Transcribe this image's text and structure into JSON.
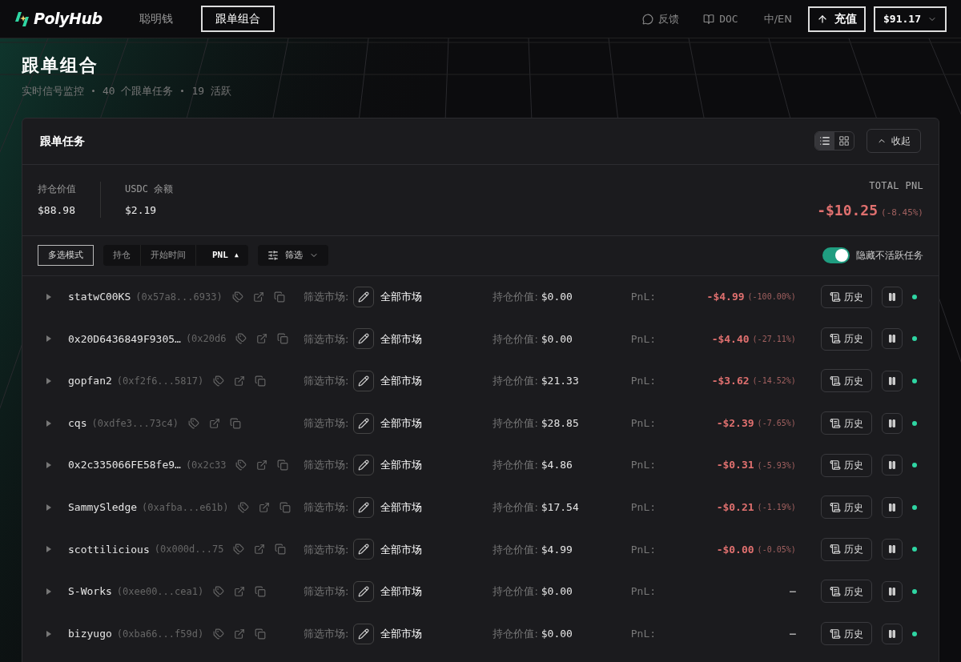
{
  "nav": {
    "logo": "PolyHub",
    "links": [
      {
        "label": "聪明钱",
        "selected": false
      },
      {
        "label": "跟单组合",
        "selected": true
      }
    ],
    "feedback": "反馈",
    "doc": "DOC",
    "language": "中/EN",
    "deposit": "充值",
    "balance": "$91.17"
  },
  "hero": {
    "title": "跟单组合",
    "subtitle": [
      "实时信号监控",
      "40 个跟单任务",
      "19 活跃"
    ]
  },
  "panel": {
    "title": "跟单任务",
    "views": [
      {
        "kind": "list",
        "selected": true
      },
      {
        "kind": "grid",
        "selected": false
      }
    ],
    "collapse": "收起",
    "stats": [
      {
        "label": "持仓价值",
        "value": "$88.98"
      },
      {
        "label": "USDC 余额",
        "value": "$2.19"
      }
    ],
    "total_pnl": {
      "label": "TOTAL PNL",
      "value": "-$10.25",
      "percent": "(-8.45%)"
    },
    "multi_select": "多选模式",
    "sort_tabs": [
      {
        "label": "持仓",
        "selected": false
      },
      {
        "label": "开始时间",
        "selected": false
      },
      {
        "label": "PNL",
        "selected": true,
        "arrow": "▲"
      }
    ],
    "filter": "筛选",
    "hide_inactive": {
      "label": "隐藏不活跃任务",
      "on": true
    },
    "tasks": [
      {
        "name": "statwC00KS",
        "address": "(0x57a8...6933)",
        "expanded": false,
        "filter_label": "筛选市场:",
        "market": "全部市场",
        "position_label": "持仓价值:",
        "position": "$0.00",
        "pnl_label": "PnL:",
        "pnl": "-$4.99",
        "pnl_percent": "(-100.00%)",
        "history": "历史",
        "active": true
      },
      {
        "name": "0x20D6436849F9305…",
        "address": "(0x20d6",
        "expanded": false,
        "filter_label": "筛选市场:",
        "market": "全部市场",
        "position_label": "持仓价值:",
        "position": "$0.00",
        "pnl_label": "PnL:",
        "pnl": "-$4.40",
        "pnl_percent": "(-27.11%)",
        "history": "历史",
        "active": true
      },
      {
        "name": "gopfan2",
        "address": "(0xf2f6...5817)",
        "expanded": false,
        "filter_label": "筛选市场:",
        "market": "全部市场",
        "position_label": "持仓价值:",
        "position": "$21.33",
        "pnl_label": "PnL:",
        "pnl": "-$3.62",
        "pnl_percent": "(-14.52%)",
        "history": "历史",
        "active": true
      },
      {
        "name": "cqs",
        "address": "(0xdfe3...73c4)",
        "expanded": false,
        "filter_label": "筛选市场:",
        "market": "全部市场",
        "position_label": "持仓价值:",
        "position": "$28.85",
        "pnl_label": "PnL:",
        "pnl": "-$2.39",
        "pnl_percent": "(-7.65%)",
        "history": "历史",
        "active": true
      },
      {
        "name": "0x2c335066FE58fe9…",
        "address": "(0x2c33",
        "expanded": false,
        "filter_label": "筛选市场:",
        "market": "全部市场",
        "position_label": "持仓价值:",
        "position": "$4.86",
        "pnl_label": "PnL:",
        "pnl": "-$0.31",
        "pnl_percent": "(-5.93%)",
        "history": "历史",
        "active": true
      },
      {
        "name": "SammySledge",
        "address": "(0xafba...e61b)",
        "expanded": false,
        "filter_label": "筛选市场:",
        "market": "全部市场",
        "position_label": "持仓价值:",
        "position": "$17.54",
        "pnl_label": "PnL:",
        "pnl": "-$0.21",
        "pnl_percent": "(-1.19%)",
        "history": "历史",
        "active": true
      },
      {
        "name": "scottilicious",
        "address": "(0x000d...75",
        "expanded": false,
        "filter_label": "筛选市场:",
        "market": "全部市场",
        "position_label": "持仓价值:",
        "position": "$4.99",
        "pnl_label": "PnL:",
        "pnl": "-$0.00",
        "pnl_percent": "(-0.05%)",
        "history": "历史",
        "active": true
      },
      {
        "name": "S-Works",
        "address": "(0xee00...cea1)",
        "expanded": false,
        "filter_label": "筛选市场:",
        "market": "全部市场",
        "position_label": "持仓价值:",
        "position": "$0.00",
        "pnl_label": "PnL:",
        "pnl": "–",
        "history": "历史",
        "active": true
      },
      {
        "name": "bizyugo",
        "address": "(0xba66...f59d)",
        "expanded": false,
        "filter_label": "筛选市场:",
        "market": "全部市场",
        "position_label": "持仓价值:",
        "position": "$0.00",
        "pnl_label": "PnL:",
        "pnl": "–",
        "history": "历史",
        "active": true
      }
    ]
  }
}
